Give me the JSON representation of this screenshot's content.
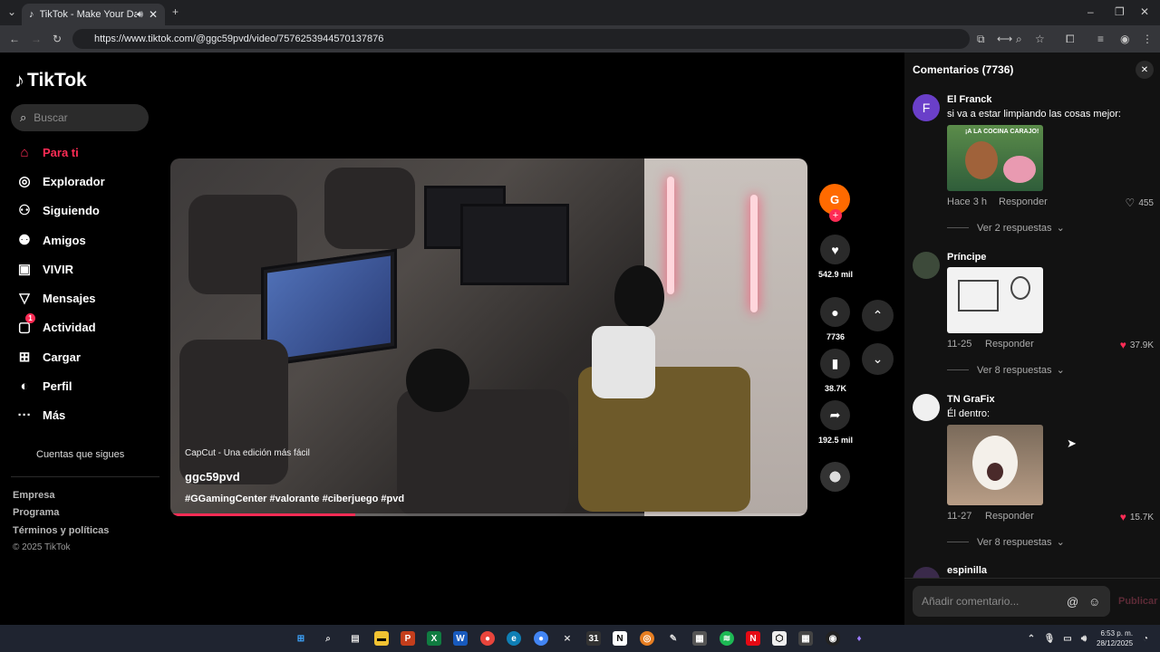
{
  "browser": {
    "tab_title": "TikTok - Make Your Day",
    "url": "https://www.tiktok.com/@ggc59pvd/video/7576253944570137876"
  },
  "sidebar": {
    "logo": "TikTok",
    "search_placeholder": "Buscar",
    "items": [
      {
        "label": "Para ti",
        "icon": "home-icon",
        "active": true
      },
      {
        "label": "Explorador",
        "icon": "compass-icon"
      },
      {
        "label": "Siguiendo",
        "icon": "following-icon"
      },
      {
        "label": "Amigos",
        "icon": "friends-icon"
      },
      {
        "label": "VIVIR",
        "icon": "live-icon"
      },
      {
        "label": "Mensajes",
        "icon": "messages-icon"
      },
      {
        "label": "Actividad",
        "icon": "activity-icon",
        "badge": "1"
      },
      {
        "label": "Cargar",
        "icon": "upload-icon"
      },
      {
        "label": "Perfil",
        "icon": "profile-icon"
      },
      {
        "label": "Más",
        "icon": "more-icon"
      }
    ],
    "following_accounts": "Cuentas que sigues",
    "footer_links": [
      "Empresa",
      "Programa",
      "Términos y políticas"
    ],
    "copyright": "© 2025 TikTok"
  },
  "video": {
    "watermark": "CapCut - Una edición más fácil",
    "username": "ggc59pvd",
    "hashtags": "#GGamingCenter #valorante #ciberjuego #pvd",
    "progress": 0.29
  },
  "actions": {
    "likes": "542.9 mil",
    "comments": "7736",
    "saves": "38.7K",
    "shares": "192.5 mil"
  },
  "comments_panel": {
    "header": "Comentarios (7736)",
    "comments": [
      {
        "avatar_letter": "F",
        "name": "El Franck",
        "text": "si va a estar limpiando las cosas mejor:",
        "image_caption": "¡A LA COCINA CARAJO!",
        "time": "Hace 3 h",
        "reply": "Responder",
        "likes": "455",
        "liked": false,
        "more_replies": "Ver 2 respuestas"
      },
      {
        "avatar_letter": "",
        "name": "Príncipe",
        "text": "",
        "time": "11-25",
        "reply": "Responder",
        "likes": "37.9K",
        "liked": true,
        "more_replies": "Ver 8 respuestas"
      },
      {
        "avatar_letter": "",
        "name": "TN GraFix",
        "text": "Él dentro:",
        "time": "11-27",
        "reply": "Responder",
        "likes": "15.7K",
        "liked": true,
        "more_replies": "Ver 8 respuestas"
      },
      {
        "avatar_letter": "",
        "name": "espinilla"
      }
    ],
    "input_placeholder": "Añadir comentario...",
    "post_label": "Publicar"
  },
  "taskbar": {
    "time": "6:53 p. m.",
    "date": "28/12/2025"
  },
  "colors": {
    "accent": "#fe2c55",
    "background": "#000000",
    "panel": "#121212"
  }
}
